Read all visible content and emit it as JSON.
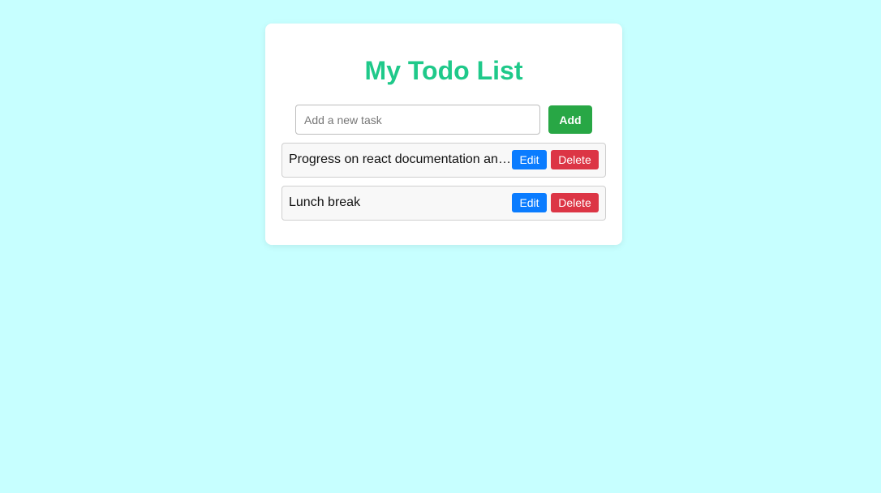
{
  "app": {
    "title": "My Todo List"
  },
  "input": {
    "placeholder": "Add a new task",
    "value": ""
  },
  "actions": {
    "add_label": "Add"
  },
  "todos": [
    {
      "text": "Progress on react documentation and tutorial",
      "edit_label": "Edit",
      "delete_label": "Delete"
    },
    {
      "text": "Lunch break",
      "edit_label": "Edit",
      "delete_label": "Delete"
    }
  ],
  "colors": {
    "background": "#c7ffff",
    "title": "#1fc98a",
    "add_button": "#28a745",
    "edit_button": "#0a7cff",
    "delete_button": "#dc3545"
  }
}
